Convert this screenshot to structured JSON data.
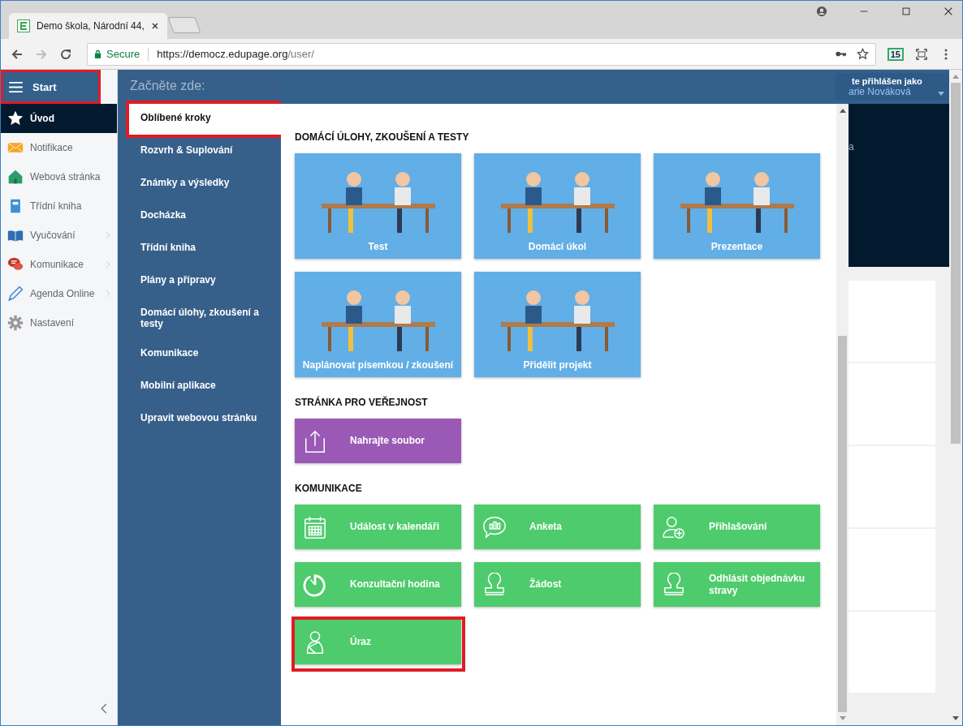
{
  "browser": {
    "tab_title": "Demo škola, Národní 44,",
    "secure_label": "Secure",
    "url_host": "https://democz.edupage.org",
    "url_path": "/user/",
    "extension_badge": "15"
  },
  "start_button": {
    "label": "Start",
    "highlighted": true
  },
  "sidebar": {
    "items": [
      {
        "label": "Úvod",
        "selected": true,
        "expandable": false
      },
      {
        "label": "Notifikace",
        "selected": false,
        "expandable": false
      },
      {
        "label": "Webová stránka",
        "selected": false,
        "expandable": false
      },
      {
        "label": "Třídní kniha",
        "selected": false,
        "expandable": false
      },
      {
        "label": "Vyučování",
        "selected": false,
        "expandable": true
      },
      {
        "label": "Komunikace",
        "selected": false,
        "expandable": true
      },
      {
        "label": "Agenda Online",
        "selected": false,
        "expandable": true
      },
      {
        "label": "Nastavení",
        "selected": false,
        "expandable": false
      }
    ]
  },
  "menu": {
    "heading": "Začněte zde:",
    "items": [
      {
        "label": "Oblíbené kroky",
        "selected": true,
        "highlighted": true
      },
      {
        "label": "Rozvrh & Suplování",
        "selected": false,
        "highlighted": false
      },
      {
        "label": "Známky a výsledky",
        "selected": false,
        "highlighted": false
      },
      {
        "label": "Docházka",
        "selected": false,
        "highlighted": false
      },
      {
        "label": "Třídní kniha",
        "selected": false,
        "highlighted": false
      },
      {
        "label": "Plány a přípravy",
        "selected": false,
        "highlighted": false
      },
      {
        "label": "Domácí úlohy, zkoušení a testy",
        "selected": false,
        "highlighted": false
      },
      {
        "label": "Komunikace",
        "selected": false,
        "highlighted": false
      },
      {
        "label": "Mobilní aplikace",
        "selected": false,
        "highlighted": false
      },
      {
        "label": "Upravit webovou stránku",
        "selected": false,
        "highlighted": false
      }
    ]
  },
  "sections": [
    {
      "title": "DOMÁCÍ ÚLOHY, ZKOUŠENÍ A TESTY",
      "tiles": [
        {
          "label": "Test",
          "kind": "illustration",
          "color": "#62aee6",
          "highlighted": false
        },
        {
          "label": "Domácí úkol",
          "kind": "illustration",
          "color": "#62aee6",
          "highlighted": false
        },
        {
          "label": "Prezentace",
          "kind": "illustration",
          "color": "#62aee6",
          "highlighted": false
        },
        {
          "label": "Naplánovat písemkou / zkoušení",
          "kind": "illustration",
          "color": "#62aee6",
          "highlighted": false
        },
        {
          "label": "Přidělit projekt",
          "kind": "illustration",
          "color": "#62aee6",
          "highlighted": false
        }
      ]
    },
    {
      "title": "STRÁNKA PRO VEŘEJNOST",
      "tiles": [
        {
          "label": "Nahrajte soubor",
          "kind": "icon",
          "color": "#9b59b6",
          "highlighted": false
        }
      ]
    },
    {
      "title": "KOMUNIKACE",
      "tiles": [
        {
          "label": "Událost v kalendáři",
          "kind": "icon",
          "color": "#4ecb6c",
          "highlighted": false
        },
        {
          "label": "Anketa",
          "kind": "icon",
          "color": "#4ecb6c",
          "highlighted": false
        },
        {
          "label": "Přihlašování",
          "kind": "icon",
          "color": "#4ecb6c",
          "highlighted": false
        },
        {
          "label": "Konzultační hodina",
          "kind": "icon",
          "color": "#4ecb6c",
          "highlighted": false
        },
        {
          "label": "Žádost",
          "kind": "icon",
          "color": "#4ecb6c",
          "highlighted": false
        },
        {
          "label": "Odhlásit objednávku stravy",
          "kind": "icon",
          "color": "#4ecb6c",
          "highlighted": false
        },
        {
          "label": "Úraz",
          "kind": "icon",
          "color": "#4ecb6c",
          "highlighted": true
        }
      ]
    }
  ],
  "user": {
    "caption": "te přihlášen jako",
    "name": "arie Nováková"
  },
  "background_fragment": "a"
}
